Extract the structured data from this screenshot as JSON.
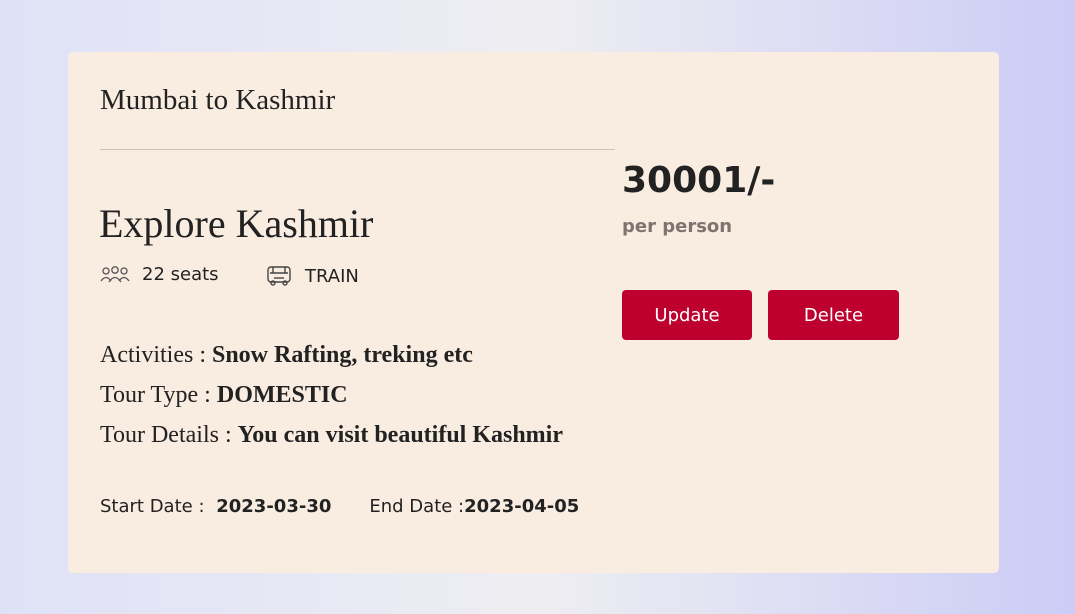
{
  "card": {
    "route": "Mumbai to Kashmir",
    "tour_name": "Explore Kashmir",
    "seats": "22 seats",
    "transport": "TRAIN",
    "activities_label": "Activities : ",
    "activities_value": "Snow Rafting, treking etc",
    "tour_type_label": "Tour Type : ",
    "tour_type_value": "DOMESTIC",
    "tour_details_label": "Tour Details : ",
    "tour_details_value": "You can visit beautiful Kashmir",
    "start_date_label": "Start Date : ",
    "start_date_value": "2023-03-30",
    "end_date_label": "End Date :",
    "end_date_value": "2023-04-05",
    "price": "30001/-",
    "price_unit": "per person",
    "update_label": "Update",
    "delete_label": "Delete"
  },
  "icons": {
    "seats": "people-group-icon",
    "transport": "bus-icon"
  },
  "colors": {
    "accent": "#be002e",
    "card_bg": "#f9ece1"
  }
}
